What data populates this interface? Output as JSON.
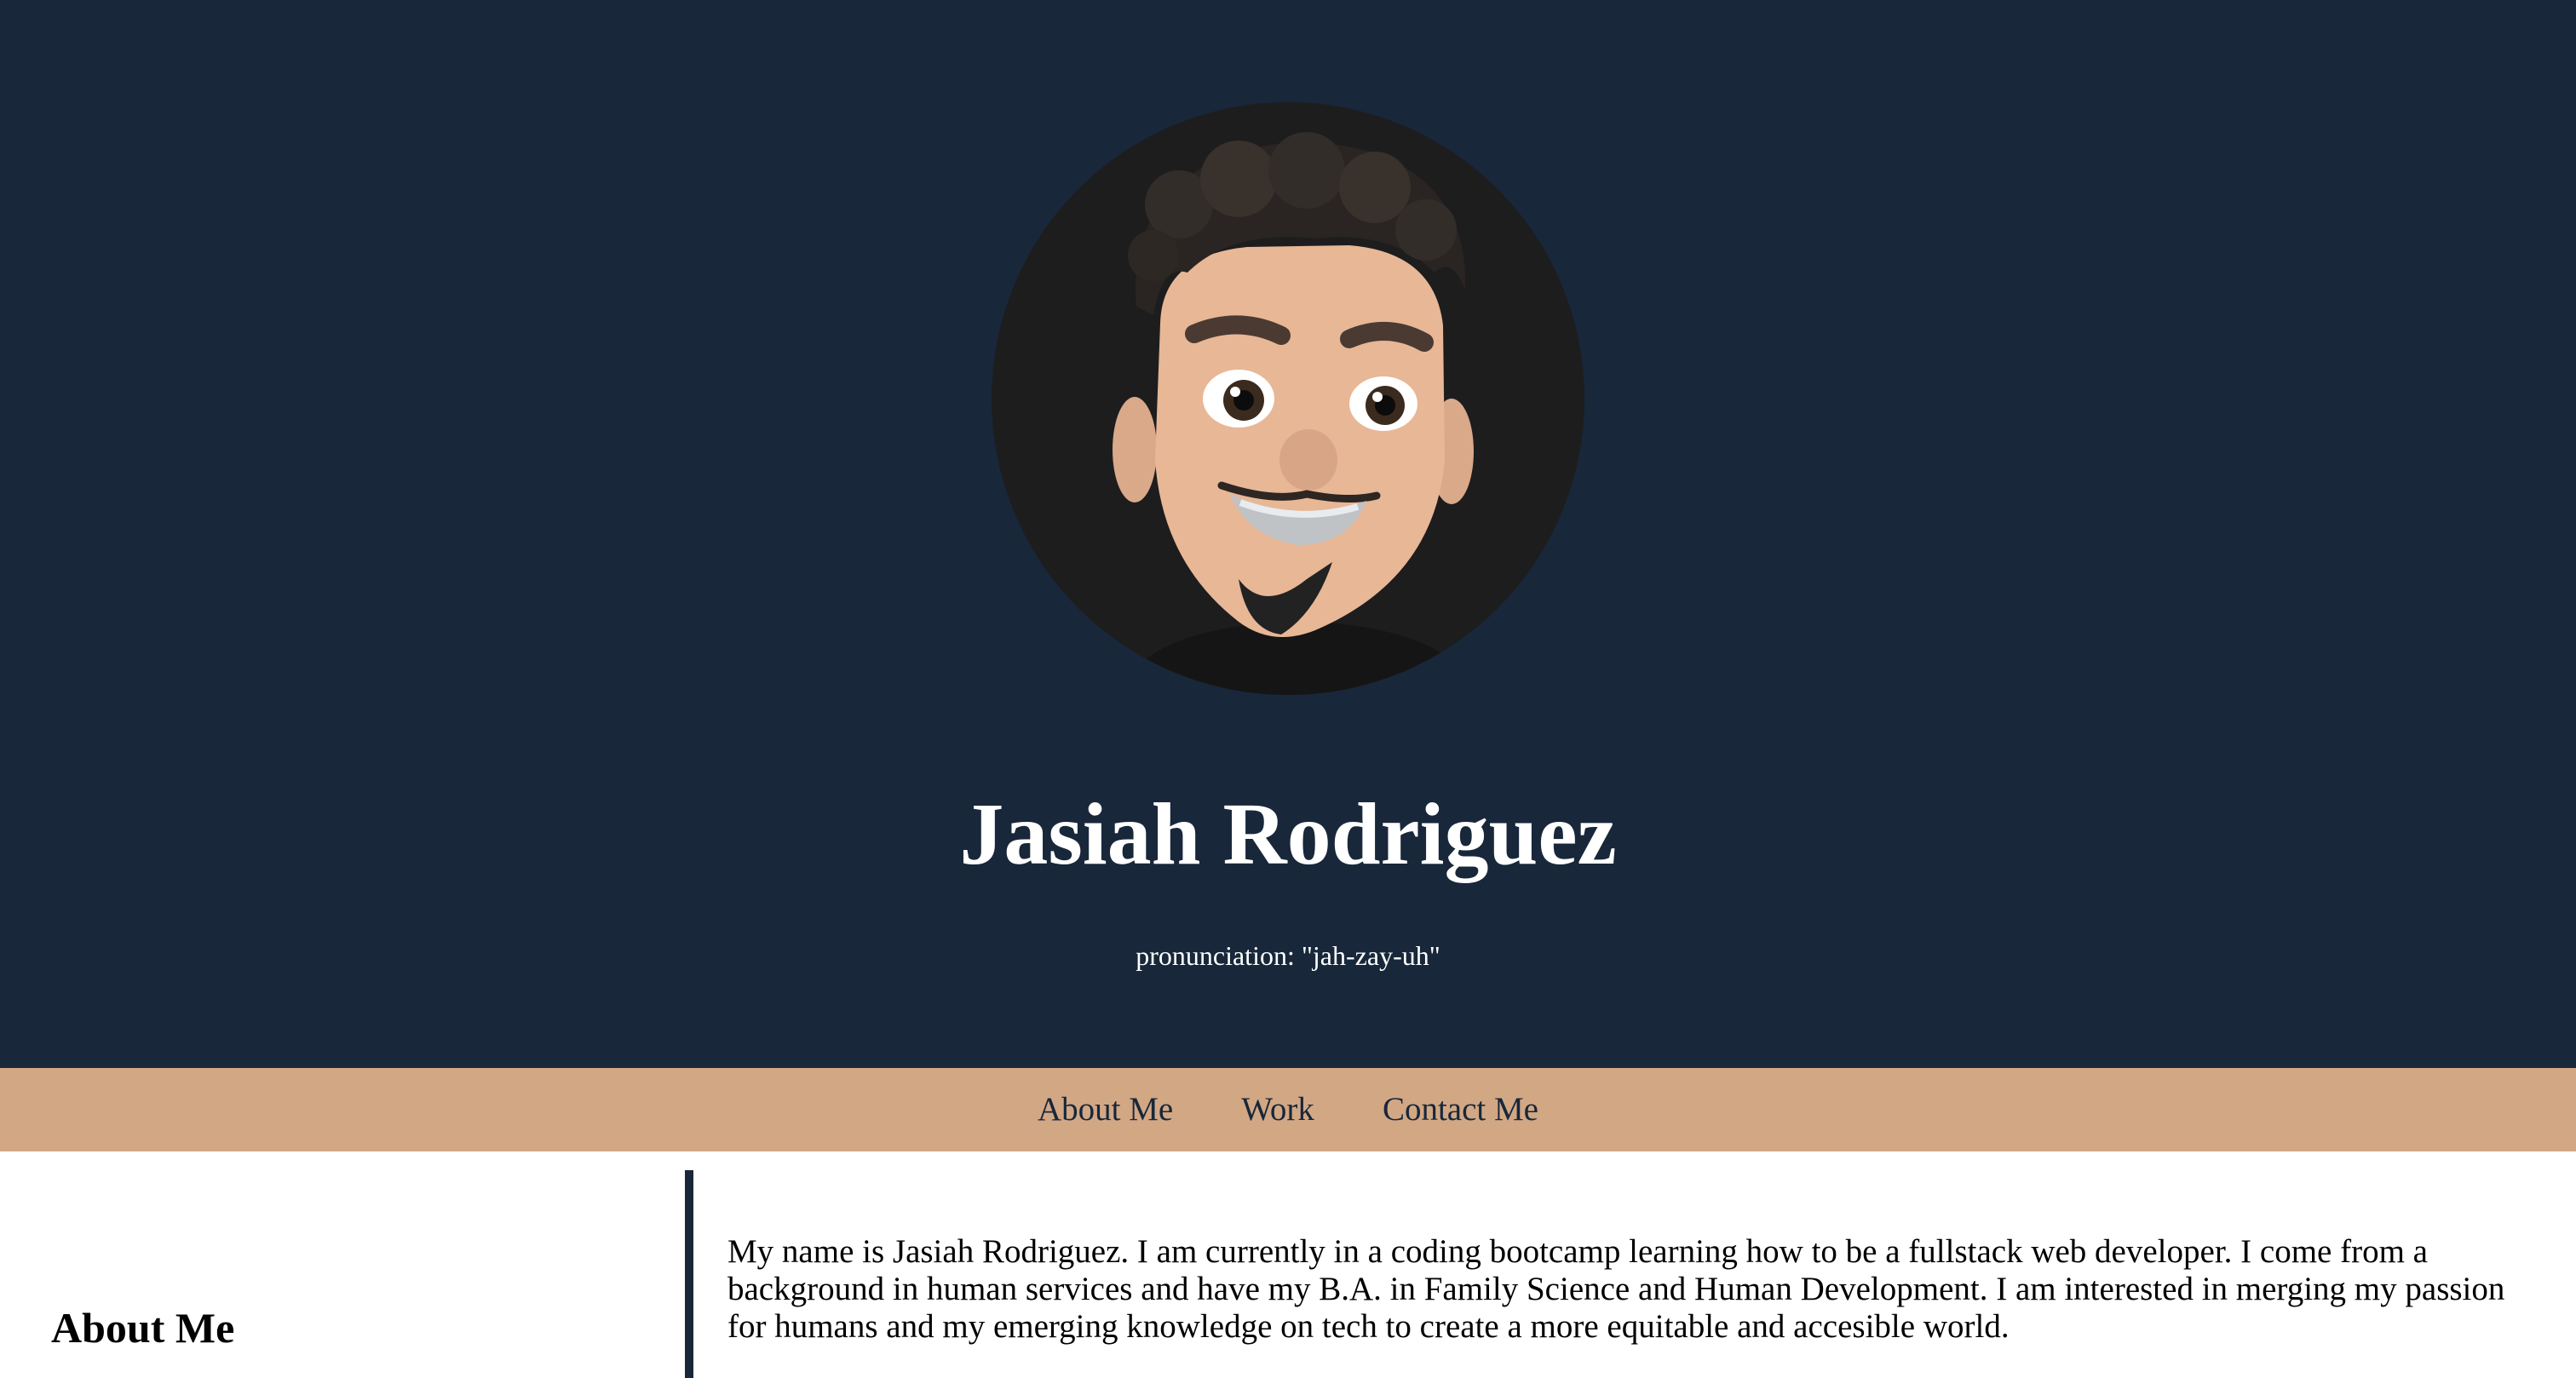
{
  "header": {
    "name": "Jasiah Rodriguez",
    "pronunciation": "pronunciation: \"jah-zay-uh\""
  },
  "avatar": {
    "icon": "memoji-avatar"
  },
  "nav": {
    "items": [
      {
        "label": "About Me"
      },
      {
        "label": "Work"
      },
      {
        "label": "Contact Me"
      }
    ]
  },
  "about": {
    "title": "About Me",
    "text": "My name is Jasiah Rodriguez. I am currently in a coding bootcamp learning how to be a fullstack web developer. I come from a background in human services and have my B.A. in Family Science and Human Development. I am interested in merging my passion for humans and my emerging knowledge on tech to create a more equitable and accesible world."
  },
  "colors": {
    "hero_bg": "#18273a",
    "nav_bg": "#d2a784",
    "avatar_bg": "#1d1d1e",
    "accent": "#18273a"
  }
}
